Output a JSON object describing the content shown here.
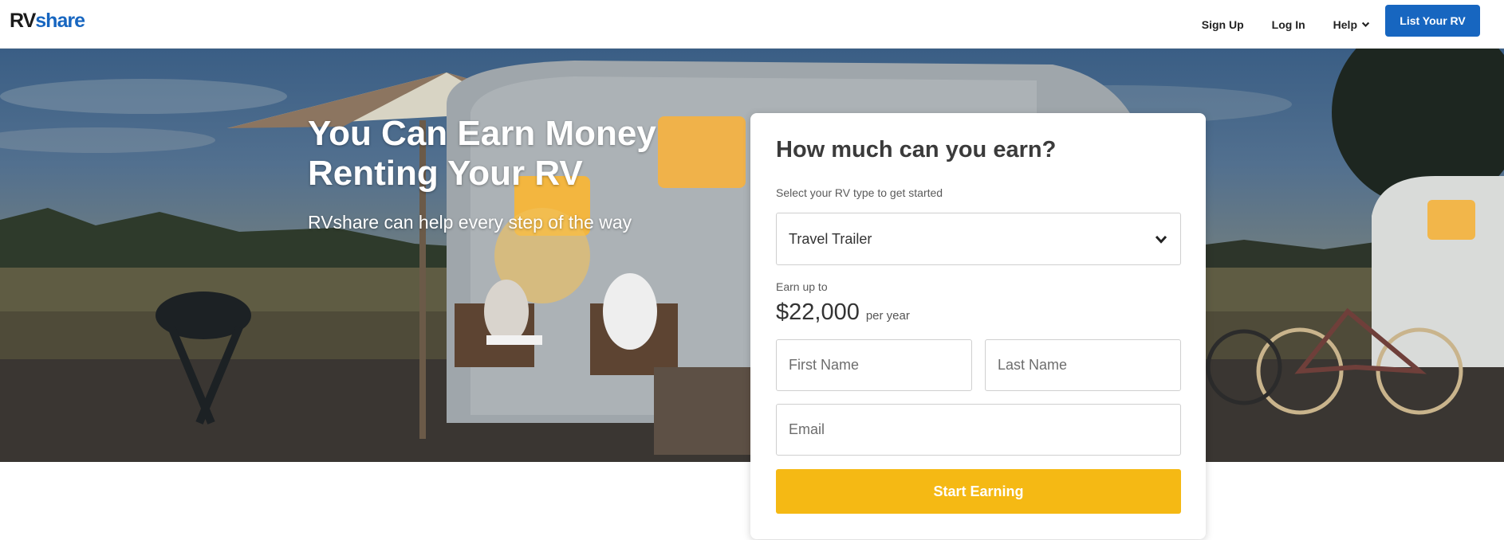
{
  "header": {
    "logo": {
      "part1": "RV",
      "part2": "share"
    },
    "nav": {
      "sign_up": "Sign Up",
      "log_in": "Log In",
      "help": "Help",
      "list_rv": "List Your RV"
    }
  },
  "hero": {
    "title": "You Can Earn Money Renting Your RV",
    "subtitle": "RVshare can help every step of the way"
  },
  "form": {
    "title": "How much can you earn?",
    "hint": "Select your RV type to get started",
    "rv_type_selected": "Travel Trailer",
    "earn_label": "Earn up to",
    "earn_amount": "$22,000",
    "earn_unit": "per year",
    "first_name_placeholder": "First Name",
    "last_name_placeholder": "Last Name",
    "email_placeholder": "Email",
    "submit_label": "Start Earning"
  },
  "colors": {
    "brand_blue": "#1766c0",
    "cta_yellow": "#f5b914"
  },
  "icons": {
    "help_dropdown": "chevron-down-icon",
    "select_dropdown": "chevron-down-icon"
  }
}
